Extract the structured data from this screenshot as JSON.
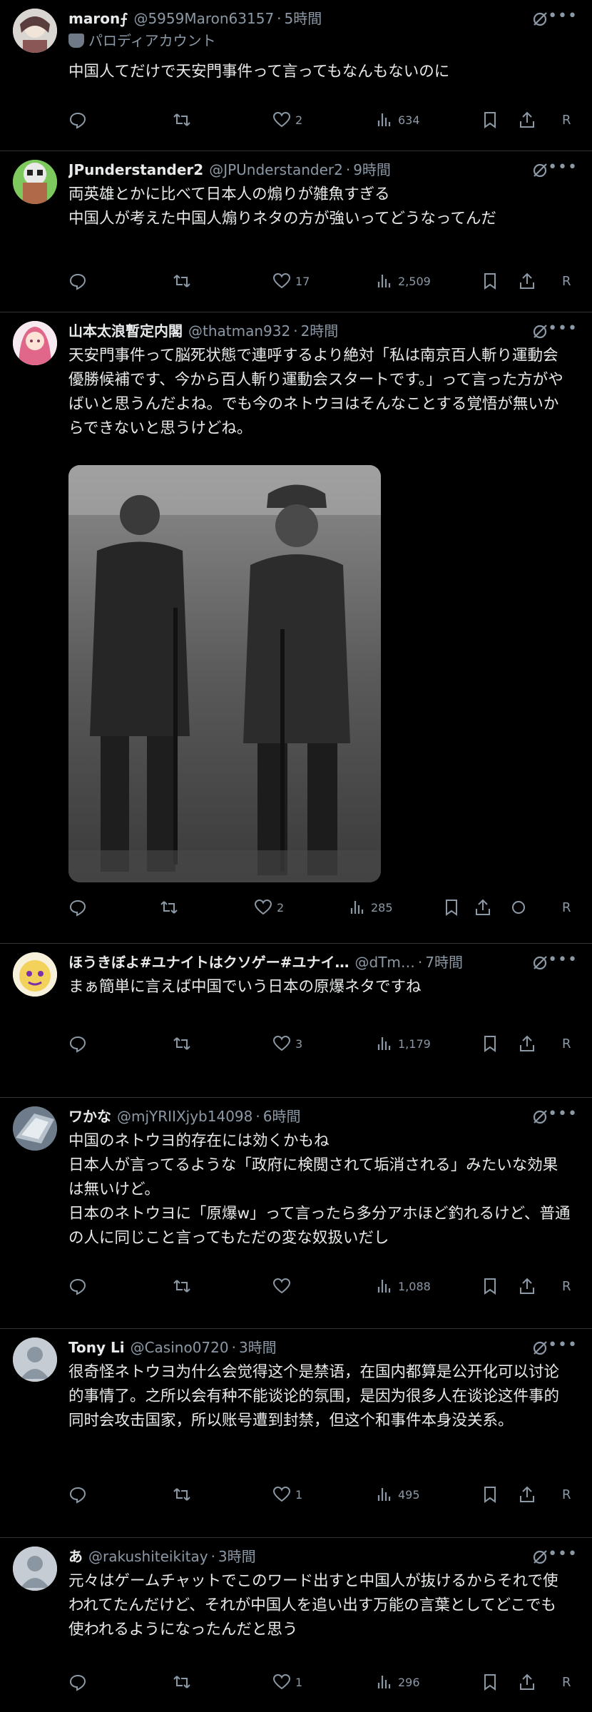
{
  "posts": [
    {
      "name": "maron⨍",
      "handle": "@5959Maron63157",
      "time": "5時間",
      "parody": "パロディアカウント",
      "text": "中国人てだけで天安門事件って言ってもなんもないのに",
      "likes": "2",
      "views": "634",
      "extra": "R"
    },
    {
      "name": "JPunderstander2",
      "handle": "@JPUnderstander2",
      "time": "9時間",
      "text": "両英雄とかに比べて日本人の煽りが雑魚すぎる\n中国人が考えた中国人煽りネタの方が強いってどうなってんだ",
      "likes": "17",
      "views": "2,509",
      "extra": "R"
    },
    {
      "name": "山本太浪暫定内閣",
      "handle": "@thatman932",
      "time": "2時間",
      "text": "天安門事件って脳死状態で連呼するより絶対「私は南京百人斬り運動会優勝候補です、今から百人斬り運動会スタートです。」って言った方がやばいと思うんだよね。でも今のネトウヨはそんなことする覚悟が無いからできないと思うけどね。",
      "likes": "2",
      "views": "285",
      "extra": "R"
    },
    {
      "name": "ほうきぼよ#ユナイトはクソゲー#ユナイ…",
      "handle": "@dTm…",
      "time": "7時間",
      "text": "まぁ簡単に言えば中国でいう日本の原爆ネタですね",
      "likes": "3",
      "views": "1,179",
      "extra": "R"
    },
    {
      "name": "ワかな",
      "handle": "@mjYRIIXjyb14098",
      "time": "6時間",
      "text": "中国のネトウヨ的存在には効くかもね\n日本人が言ってるような「政府に検閲されて垢消される」みたいな効果は無いけど。\n日本のネトウヨに「原爆w」って言ったら多分アホほど釣れるけど、普通の人に同じこと言ってもただの変な奴扱いだし",
      "likes": "",
      "views": "1,088",
      "extra": "R"
    },
    {
      "name": "Tony Li",
      "handle": "@Casino0720",
      "time": "3時間",
      "text": "很奇怪ネトウヨ为什么会觉得这个是禁语，在国内都算是公开化可以讨论的事情了。之所以会有种不能谈论的氛围，是因为很多人在谈论这件事的同时会攻击国家，所以账号遭到封禁，但这个和事件本身没关系。",
      "likes": "1",
      "views": "495",
      "extra": "R"
    },
    {
      "name": "あ",
      "handle": "@rakushiteikitay",
      "time": "3時間",
      "text": "元々はゲームチャットでこのワード出すと中国人が抜けるからそれで使われてたんだけど、それが中国人を追い出す万能の言葉としてどこでも使われるようになったんだと思う",
      "likes": "1",
      "views": "296",
      "extra": "R"
    }
  ]
}
